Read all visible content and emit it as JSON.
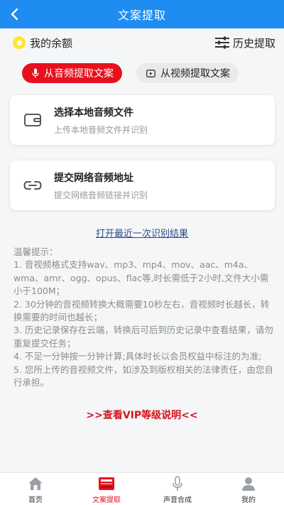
{
  "header": {
    "title": "文案提取"
  },
  "top": {
    "balance_label": "我的余额",
    "history_label": "历史提取"
  },
  "tabs": [
    {
      "label": "从音频提取文案",
      "active": true
    },
    {
      "label": "从视频提取文案",
      "active": false
    }
  ],
  "cards": [
    {
      "title": "选择本地音频文件",
      "subtitle": "上传本地音频文件并识别"
    },
    {
      "title": "提交网络音频地址",
      "subtitle": "提交网络音频链接并识别"
    }
  ],
  "open_last_result": "打开最近一次识别结果",
  "tips": [
    "温馨提示：",
    "1. 音视频格式支持wav、mp3、mp4、mov、aac、m4a、wma、amr、ogg、opus、flac等,时长需低于2小时,文件大小需小于100M；",
    "2. 30分钟的音视频转换大概需要10秒左右，音视频时长越长，转换需要的时间也越长；",
    "3. 历史记录保存在云端，转换后可后到历史记录中查看结果，请勿重复提交任务；",
    "4. 不足一分钟按一分钟计算;具体时长以会员权益中标注的为准;",
    "5. 您所上传的音视频文件，如涉及到版权相关的法律责任，由您自行承担。"
  ],
  "vip_link": ">>查看VIP等级说明<<",
  "nav": [
    {
      "label": "首页",
      "icon": "home-icon",
      "active": false
    },
    {
      "label": "文案提取",
      "icon": "document-extract-icon",
      "active": true
    },
    {
      "label": "声音合成",
      "icon": "microphone-icon",
      "active": false
    },
    {
      "label": "我的",
      "icon": "user-icon",
      "active": false
    }
  ],
  "colors": {
    "primary": "#1e8cf0",
    "accent": "#e8101c",
    "coin": "#ffe533"
  }
}
